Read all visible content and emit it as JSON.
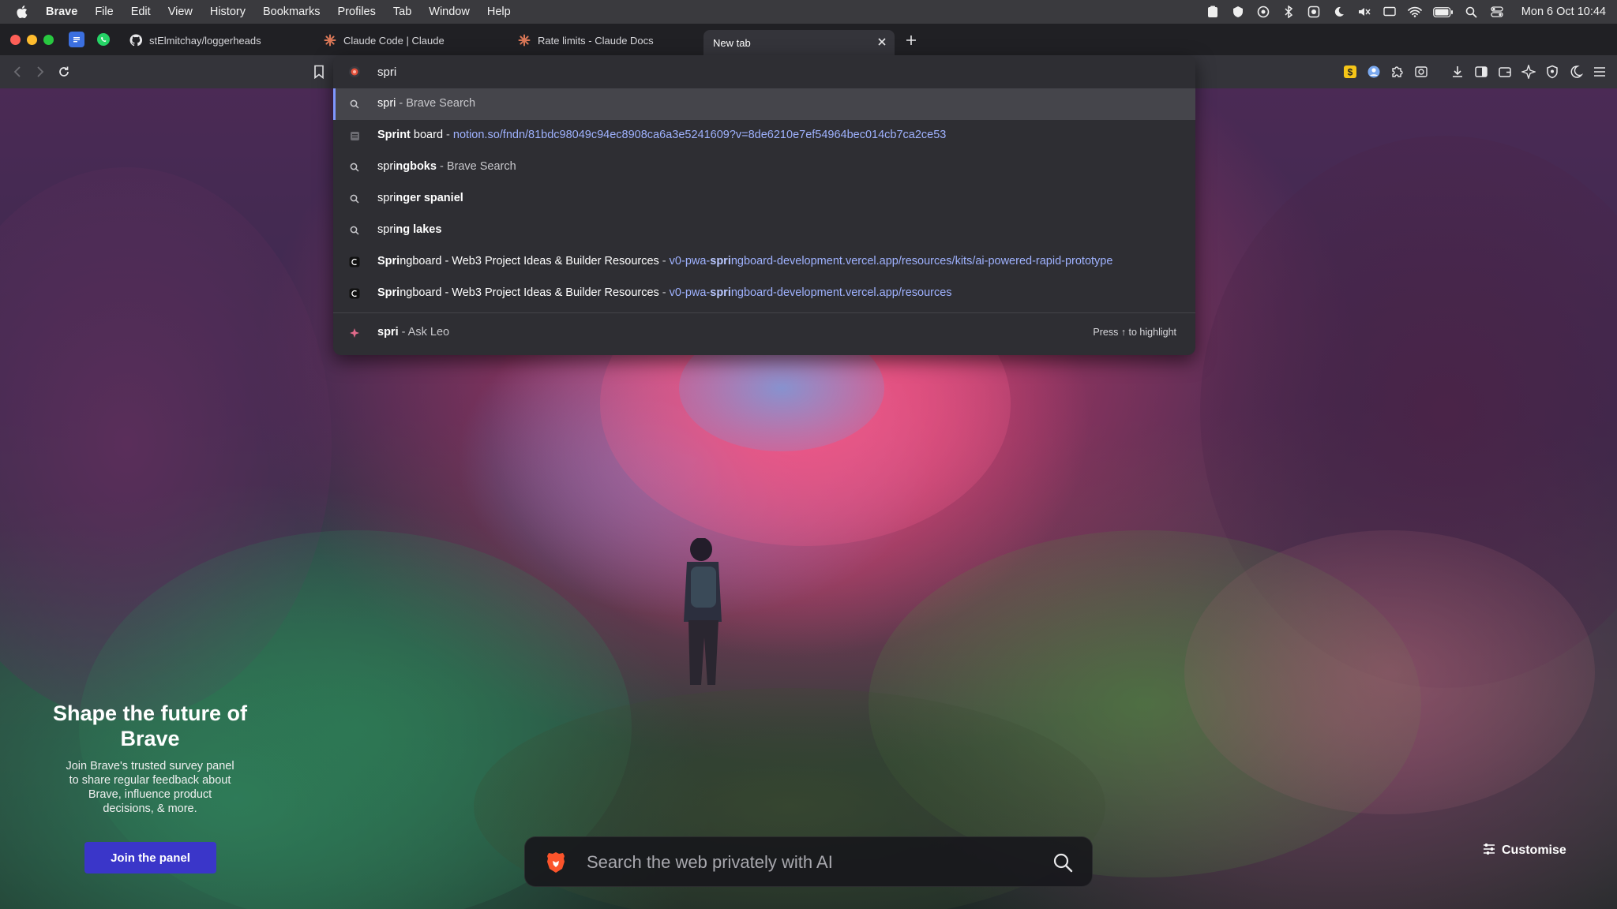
{
  "menubar": {
    "app": "Brave",
    "items": [
      "File",
      "Edit",
      "View",
      "History",
      "Bookmarks",
      "Profiles",
      "Tab",
      "Window",
      "Help"
    ],
    "clock": "Mon 6 Oct  10:44",
    "status_icons": [
      "clipboard-icon",
      "vpn-icon",
      "privacy-icon",
      "bluetooth-icon",
      "screen-record-icon",
      "focus-moon-icon",
      "mute-icon",
      "display-icon",
      "wifi-icon",
      "battery-icon",
      "spotlight-icon",
      "control-center-icon"
    ]
  },
  "tabs": {
    "items": [
      {
        "label": "stElmitchay/loggerheads",
        "icon": "github-icon"
      },
      {
        "label": "Claude Code | Claude",
        "icon": "claude-icon"
      },
      {
        "label": "Rate limits - Claude Docs",
        "icon": "claude-icon"
      },
      {
        "label": "New tab",
        "icon": ""
      }
    ],
    "colors": {
      "claude": "#d97757",
      "active_tab": "#34343a"
    }
  },
  "omnibox": {
    "value": "spri",
    "suggestions": [
      {
        "bold": "spri",
        "rest": " - Brave Search",
        "icon": "search-icon"
      },
      {
        "bold": "Sprint",
        "rest": " board",
        "url_pre": "notion.so/fndn/81bdc98049c94ec8908ca6a3e5241609?v=8de6210e7ef54964bec014cb7ca2ce53",
        "icon": "notion-icon"
      },
      {
        "pre": "spri",
        "bold": "ngboks",
        "rest": " - Brave Search",
        "icon": "search-icon"
      },
      {
        "pre": "spri",
        "bold": "nger spaniel",
        "icon": "search-icon"
      },
      {
        "pre": "spri",
        "bold": "ng lakes",
        "icon": "search-icon"
      },
      {
        "bold": "Spri",
        "rest": "ngboard - Web3 Project Ideas & Builder Resources",
        "url_pre": "v0-pwa-",
        "url_bold": "spri",
        "url_post": "ngboard-development.vercel.app/resources/kits/ai-powered-rapid-prototype",
        "icon": "vercel-icon"
      },
      {
        "bold": "Spri",
        "rest": "ngboard - Web3 Project Ideas & Builder Resources",
        "url_pre": "v0-pwa-",
        "url_bold": "spri",
        "url_post": "ngboard-development.vercel.app/resources",
        "icon": "vercel-icon"
      }
    ],
    "leo": {
      "bold": "spri",
      "rest": " - Ask Leo",
      "hint": "Press ↑ to highlight",
      "icon": "leo-icon"
    },
    "dash": " - "
  },
  "promo": {
    "title": "Shape the future of Brave",
    "body": "Join Brave's trusted survey panel to share regular feedback about Brave, influence product decisions, & more.",
    "button": "Join the panel"
  },
  "search": {
    "placeholder": "Search the web privately with AI"
  },
  "customise": {
    "label": "Customise"
  }
}
